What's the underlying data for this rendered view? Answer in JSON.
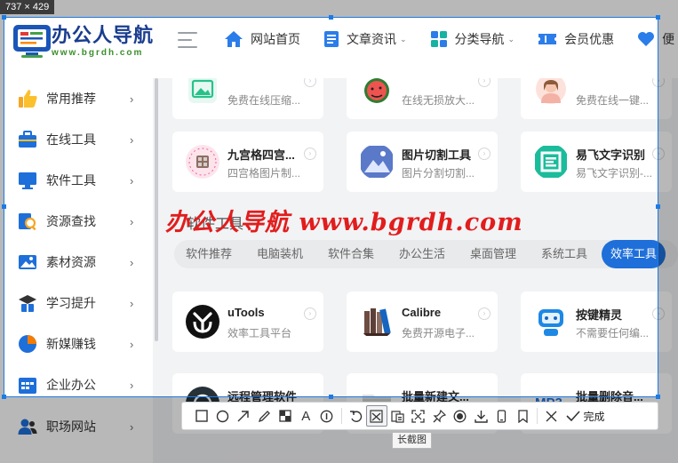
{
  "selection_size": "737 × 429",
  "brand": {
    "title": "办公人导航",
    "url": "www.bgrdh.com"
  },
  "topnav": [
    {
      "label": "网站首页",
      "icon": "home-icon",
      "caret": false
    },
    {
      "label": "文章资讯",
      "icon": "document-icon",
      "caret": true
    },
    {
      "label": "分类导航",
      "icon": "grid-icon",
      "caret": true
    },
    {
      "label": "会员优惠",
      "icon": "ticket-icon",
      "caret": false
    },
    {
      "label": "便",
      "icon": "heart-icon",
      "caret": false
    }
  ],
  "sidebar": [
    {
      "label": "常用推荐",
      "icon": "thumbs-up-icon"
    },
    {
      "label": "在线工具",
      "icon": "toolbox-icon"
    },
    {
      "label": "软件工具",
      "icon": "monitor-icon"
    },
    {
      "label": "资源查找",
      "icon": "search-icon"
    },
    {
      "label": "素材资源",
      "icon": "image-icon"
    },
    {
      "label": "学习提升",
      "icon": "study-icon"
    },
    {
      "label": "新媒赚钱",
      "icon": "pie-chart-icon"
    },
    {
      "label": "企业办公",
      "icon": "calendar-icon"
    },
    {
      "label": "职场网站",
      "icon": "users-icon"
    }
  ],
  "cards_top": [
    {
      "title": "",
      "desc": "免费在线压缩...",
      "icon": "picture-compress-icon"
    },
    {
      "title": "",
      "desc": "在线无损放大...",
      "icon": "watermelon-icon"
    },
    {
      "title": "",
      "desc": "免费在线一键...",
      "icon": "avatar-girl-icon"
    }
  ],
  "cards_row2": [
    {
      "title": "九宫格四宫...",
      "desc": "四宫格图片制...",
      "icon": "grid-photo-icon"
    },
    {
      "title": "图片切割工具",
      "desc": "图片分割切割...",
      "icon": "mountain-photo-icon"
    },
    {
      "title": "易飞文字识别",
      "desc": "易飞文字识别-...",
      "icon": "ocr-icon"
    }
  ],
  "section": {
    "title": "软件工具"
  },
  "tabs": [
    {
      "label": "软件推荐",
      "active": false
    },
    {
      "label": "电脑装机",
      "active": false
    },
    {
      "label": "软件合集",
      "active": false
    },
    {
      "label": "办公生活",
      "active": false
    },
    {
      "label": "桌面管理",
      "active": false
    },
    {
      "label": "系统工具",
      "active": false
    },
    {
      "label": "效率工具",
      "active": true
    }
  ],
  "cards_row3": [
    {
      "title": "uTools",
      "desc": "效率工具平台",
      "icon": "utools-icon"
    },
    {
      "title": "Calibre",
      "desc": "免费开源电子...",
      "icon": "books-icon"
    },
    {
      "title": "按键精灵",
      "desc": "不需要任何编...",
      "icon": "robot-icon"
    }
  ],
  "cards_row4": [
    {
      "title": "远程管理软件",
      "desc": "",
      "icon": "remote-icon"
    },
    {
      "title": "批量新建文...",
      "desc": "",
      "icon": "folder-icon"
    },
    {
      "title": "批量删除音...",
      "desc": "",
      "icon": "mp3-icon"
    }
  ],
  "watermark": "办公人导航 www.bgrdh.com",
  "toolbar": {
    "tools": [
      "rectangle",
      "ellipse",
      "arrow",
      "pen",
      "mosaic",
      "text",
      "number",
      "undo",
      "long-screenshot",
      "ocr",
      "scroll-capture",
      "pin",
      "record",
      "save",
      "phone",
      "favorite",
      "close"
    ],
    "done_label": "完成",
    "tooltip": "长截图"
  },
  "colors": {
    "accent": "#1d7be5",
    "brand_blue": "#1a3d8f",
    "tab_active": "#1e6fd9",
    "watermark": "#e11d1d"
  }
}
